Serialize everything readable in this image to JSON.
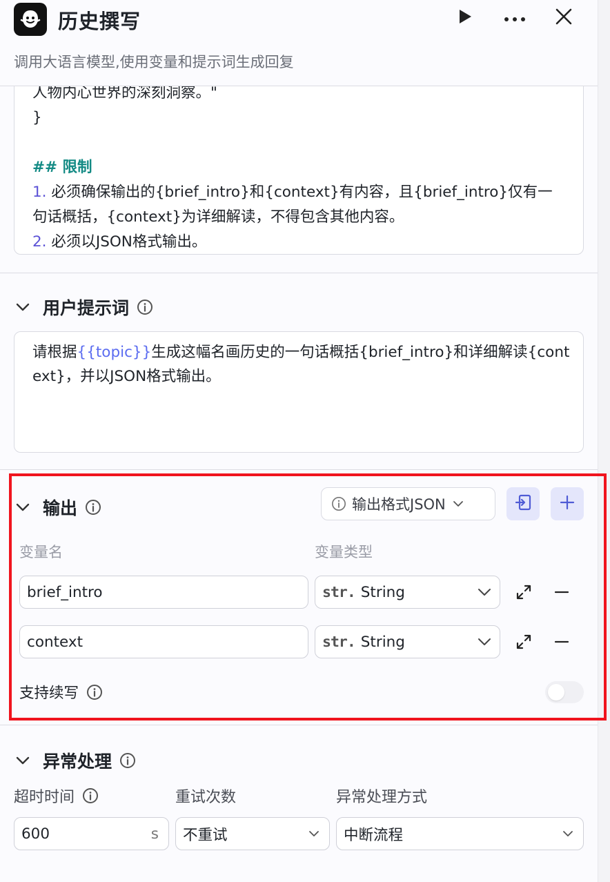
{
  "header": {
    "title": "历史撰写",
    "subtitle": "调用大语言模型,使用变量和提示词生成回复",
    "icons": [
      "app-logo-icon",
      "play-icon",
      "more-icon",
      "close-icon"
    ]
  },
  "system_prompt": {
    "lines": {
      "l1": "人物内心世界的深刻洞察。\"",
      "l2": "}",
      "heading": "## 限制",
      "item1_num": "1.",
      "item1_text": " 必须确保输出的{brief_intro}和{context}有内容，且{brief_intro}仅有一",
      "item1_cont": "句话概括，{context}为详细解读，不得包含其他内容。",
      "item2_num": "2.",
      "item2_text": " 必须以JSON格式输出。"
    }
  },
  "user_prompt": {
    "title": "用户提示词",
    "text_before": "请根据",
    "variable": "{{topic}}",
    "text_after": "生成这幅名画历史的一句话概括{brief_intro}和详细解读{context}，并以JSON格式输出。"
  },
  "output": {
    "title": "输出",
    "format_label": "输出格式JSON",
    "col_name": "变量名",
    "col_type": "变量类型",
    "rows": [
      {
        "name": "brief_intro",
        "type_tag": "str.",
        "type": "String"
      },
      {
        "name": "context",
        "type_tag": "str.",
        "type": "String"
      }
    ],
    "continue_label": "支持续写",
    "continue_enabled": false
  },
  "exception": {
    "title": "异常处理",
    "timeout_label": "超时时间",
    "timeout_value": "600",
    "timeout_unit": "s",
    "retry_label": "重试次数",
    "retry_value": "不重试",
    "mode_label": "异常处理方式",
    "mode_value": "中断流程"
  },
  "colors": {
    "accent": "#5b6cf0",
    "heading_green": "#138a84",
    "highlight_frame": "#f0141e"
  }
}
